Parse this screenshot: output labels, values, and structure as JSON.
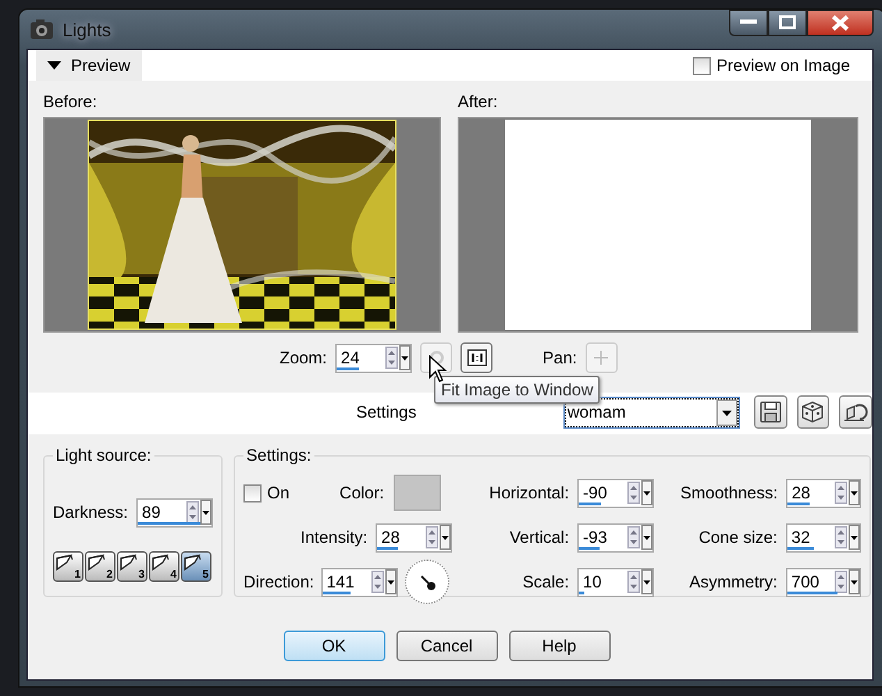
{
  "window": {
    "title": "Lights"
  },
  "preview": {
    "label": "Preview",
    "expanded": true,
    "preview_on_image": {
      "label": "Preview on Image",
      "checked": false
    },
    "before_label": "Before:",
    "after_label": "After:"
  },
  "zoom": {
    "label": "Zoom:",
    "value": "24",
    "level": 0.3
  },
  "pan_label": "Pan:",
  "tooltip": "Fit Image to Window",
  "settings_bar": {
    "label": "Settings",
    "value": "womam"
  },
  "light_source": {
    "title": "Light source:",
    "darkness": {
      "label": "Darkness:",
      "value": "89",
      "level": 0.85
    },
    "presets": [
      {
        "label": "1",
        "selected": false
      },
      {
        "label": "2",
        "selected": false
      },
      {
        "label": "3",
        "selected": false
      },
      {
        "label": "4",
        "selected": false
      },
      {
        "label": "5",
        "selected": true
      }
    ]
  },
  "settings": {
    "title": "Settings:",
    "on": {
      "label": "On",
      "checked": false
    },
    "color_label": "Color:",
    "left": [
      {
        "label": "Intensity:",
        "value": "28",
        "level": 0.28
      },
      {
        "label": "Direction:",
        "value": "141",
        "level": 0.39
      }
    ],
    "middle": [
      {
        "label": "Horizontal:",
        "value": "-90",
        "level": 0.3
      },
      {
        "label": "Vertical:",
        "value": "-93",
        "level": 0.28
      },
      {
        "label": "Scale:",
        "value": "10",
        "level": 0.08
      }
    ],
    "right": [
      {
        "label": "Smoothness:",
        "value": "28",
        "level": 0.3
      },
      {
        "label": "Cone size:",
        "value": "32",
        "level": 0.37
      },
      {
        "label": "Asymmetry:",
        "value": "700",
        "level": 0.7
      }
    ]
  },
  "buttons": [
    {
      "label": "OK",
      "default": true
    },
    {
      "label": "Cancel",
      "default": false
    },
    {
      "label": "Help",
      "default": false
    }
  ]
}
